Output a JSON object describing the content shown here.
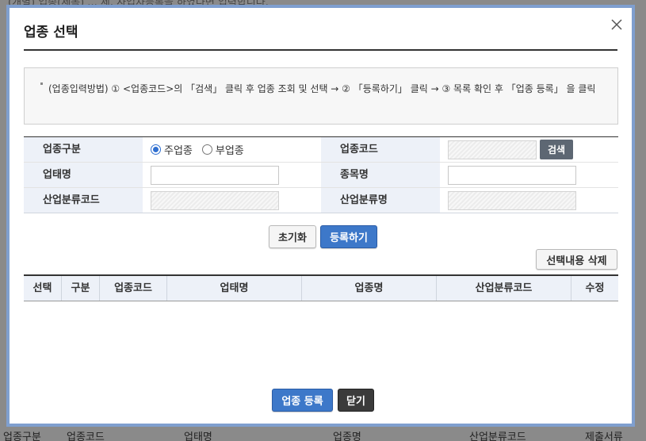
{
  "background": {
    "top_text": "(개별) 업종(세목) ... 세, 사업자등록을 하였다면 입력합니다.",
    "columns": [
      "업종구분",
      "업종코드",
      "업태명",
      "업종명",
      "산업분류코드",
      "제출서류"
    ]
  },
  "modal": {
    "title": "업종 선택",
    "close_icon": "close-icon",
    "guide_text": "(업종입력방법) ① <업종코드>의 「검색」 클릭 후 업종 조회 및 선택 → ② 「등록하기」 클릭 → ③ 목록 확인 후 「업종 등록」 을 클릭",
    "form": {
      "type_label": "업종구분",
      "type_options": [
        {
          "label": "주업종",
          "checked": true
        },
        {
          "label": "부업종",
          "checked": false
        }
      ],
      "code_label": "업종코드",
      "code_value": "",
      "search_button": "검색",
      "business_name_label": "업태명",
      "business_name_value": "",
      "item_name_label": "종목명",
      "item_name_value": "",
      "industry_code_label": "산업분류코드",
      "industry_code_value": "",
      "industry_name_label": "산업분류명",
      "industry_name_value": ""
    },
    "reset_button": "초기화",
    "register_button": "등록하기",
    "delete_selected_button": "선택내용 삭제",
    "grid": {
      "columns": [
        "선택",
        "구분",
        "업종코드",
        "업태명",
        "업종명",
        "산업분류코드",
        "수정"
      ],
      "rows": []
    },
    "submit_button": "업종 등록",
    "close_button": "닫기"
  },
  "colors": {
    "accent_blue": "#3d78c9",
    "header_bg": "#edf1f8",
    "dark_button": "#3b3b3b",
    "search_button": "#5d6773"
  }
}
